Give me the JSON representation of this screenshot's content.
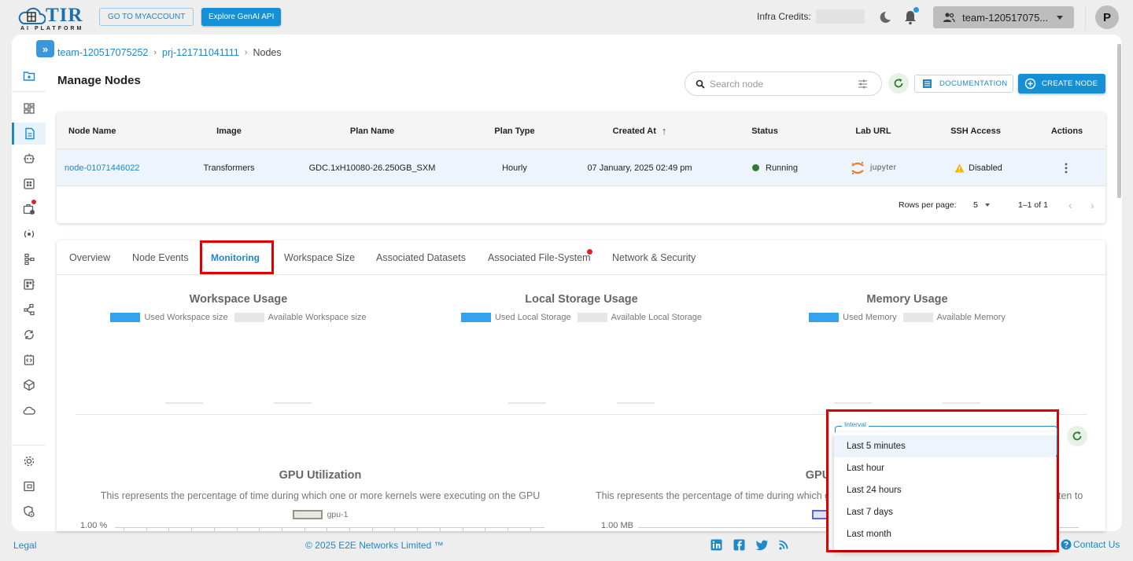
{
  "topbar": {
    "logo_text": "TIR",
    "logo_subtitle": "AI PLATFORM",
    "myaccount_label": "GO TO MYACCOUNT",
    "genai_label": "Explore GenAI API",
    "credits_label": "Infra Credits:",
    "team_select_value": "team-120517075...",
    "avatar_initial": "P"
  },
  "sidebar": {
    "items": [
      {
        "icon": "folder-add-icon"
      },
      {
        "icon": "dashboard-icon"
      },
      {
        "icon": "document-icon",
        "active": true
      },
      {
        "icon": "robot-icon"
      },
      {
        "icon": "grid-icon"
      },
      {
        "icon": "briefcase-clock-icon",
        "badge": true
      },
      {
        "icon": "pipeline-rotate-icon"
      },
      {
        "icon": "hierarchy-icon"
      },
      {
        "icon": "registry-icon"
      },
      {
        "icon": "share-nodes-icon"
      },
      {
        "icon": "sync-icon"
      },
      {
        "icon": "code-box-icon"
      },
      {
        "icon": "cube-icon"
      },
      {
        "icon": "cloud-icon"
      },
      {
        "icon": "settings-icon"
      },
      {
        "icon": "wallet-icon"
      },
      {
        "icon": "shield-info-icon"
      }
    ]
  },
  "breadcrumb": {
    "team": "team-120517075252",
    "project": "prj-121711041111",
    "current": "Nodes",
    "separator": "›"
  },
  "page": {
    "title": "Manage Nodes",
    "search_placeholder": "Search node",
    "documentation_label": "DOCUMENTATION",
    "create_label": "CREATE NODE"
  },
  "table": {
    "columns": [
      "Node Name",
      "Image",
      "Plan Name",
      "Plan Type",
      "Created At",
      "Status",
      "Lab URL",
      "SSH Access",
      "Actions"
    ],
    "sort_indicator": "↑",
    "rows": [
      {
        "node_name": "node-01071446022",
        "image": "Transformers",
        "plan_name": "GDC.1xH10080-26.250GB_SXM",
        "plan_type": "Hourly",
        "created_at": "07 January, 2025 02:49 pm",
        "status": "Running",
        "lab_url": "jupyter",
        "ssh_access": "Disabled"
      }
    ],
    "rows_per_page_label": "Rows per page:",
    "rows_per_page_value": "5",
    "range_label": "1–1 of 1"
  },
  "tabs": [
    {
      "label": "Overview"
    },
    {
      "label": "Node Events"
    },
    {
      "label": "Monitoring",
      "active": true
    },
    {
      "label": "Workspace Size"
    },
    {
      "label": "Associated Datasets"
    },
    {
      "label": "Associated File-System",
      "badge": true
    },
    {
      "label": "Network & Security"
    }
  ],
  "gauges": [
    {
      "title": "Workspace Usage",
      "used_label": "Used Workspace size",
      "avail_label": "Available Workspace size",
      "used_fraction": 0
    },
    {
      "title": "Local Storage Usage",
      "used_label": "Used Local Storage",
      "avail_label": "Available Local Storage",
      "used_fraction": 0
    },
    {
      "title": "Memory Usage",
      "used_label": "Used Memory",
      "avail_label": "Available Memory",
      "used_fraction": 0
    }
  ],
  "colors": {
    "used": "#36a2eb",
    "available": "#e6e6e6",
    "accent": "#1590d4",
    "running": "#2e7d32",
    "warning": "#f5b400",
    "highlight": "#e00000"
  },
  "interval": {
    "label": "Interval",
    "options": [
      "Last 5 minutes",
      "Last hour",
      "Last 24 hours",
      "Last 7 days",
      "Last month"
    ],
    "highlighted": "Last 5 minutes"
  },
  "chart_data": [
    {
      "type": "line",
      "title": "GPU Utilization",
      "subtitle": "This represents the percentage of time during which one or more kernels were executing on the GPU",
      "series": [
        {
          "name": "gpu-1",
          "values": []
        }
      ],
      "ytick_top": "1.00 %",
      "legend": "top"
    },
    {
      "type": "line",
      "title": "GPU Mem",
      "subtitle_left": "This represents the percentage of time during which g",
      "subtitle_right": "ten to",
      "series": [
        {
          "name": "",
          "values": []
        }
      ],
      "ytick_top": "1.00 MB",
      "legend": "top"
    }
  ],
  "footer": {
    "legal": "Legal",
    "copyright": "© 2025 E2E Networks Limited ™",
    "social": [
      "linkedin-icon",
      "facebook-icon",
      "twitter-icon",
      "rss-icon"
    ],
    "contact": "Contact Us"
  }
}
